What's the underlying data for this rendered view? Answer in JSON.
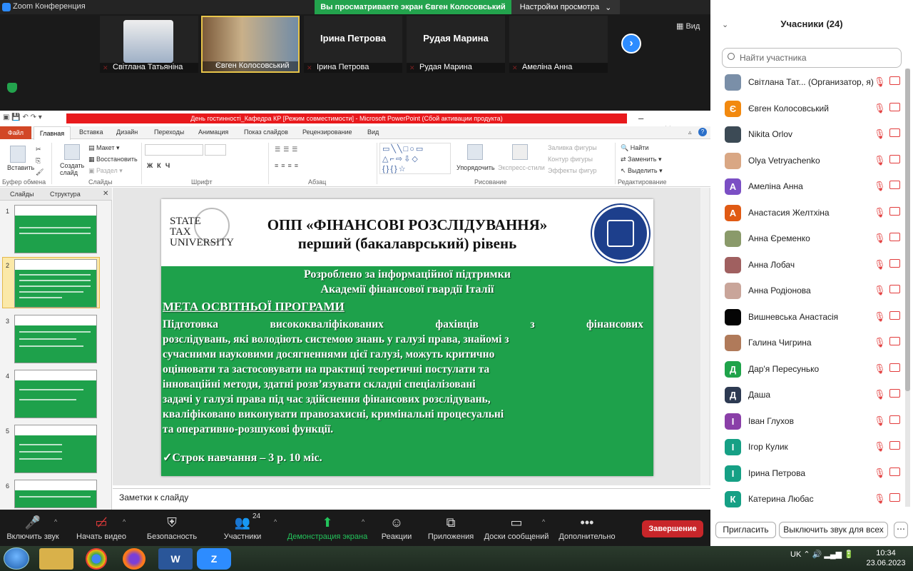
{
  "app": {
    "title": "Zoom Конференция",
    "share_banner": "Вы просматриваете экран Євген Колосовський",
    "view_settings": "Настройки просмотра",
    "view_button": "Вид"
  },
  "gallery": [
    {
      "name": "Світлана Татьяніна",
      "photo": true,
      "color": "#7a8fa8"
    },
    {
      "name": "Євген Колосовський",
      "photo": true,
      "color": "#8b6b4a"
    },
    {
      "name": "Ірина Петрова",
      "display": "Ірина Петрова"
    },
    {
      "name": "Рудая Марина",
      "display": "Рудая Марина"
    },
    {
      "name": "Амеліна Анна",
      "display": ""
    }
  ],
  "ppt": {
    "title": "День гостинності_Кафедра КР [Режим совместимости] - Microsoft PowerPoint (Сбой активации продукта)",
    "tabs": [
      "Файл",
      "Главная",
      "Вставка",
      "Дизайн",
      "Переходы",
      "Анимация",
      "Показ слайдов",
      "Рецензирование",
      "Вид"
    ],
    "groups": [
      "Буфер обмена",
      "Слайды",
      "Шрифт",
      "Абзац",
      "Рисование",
      "Редактирование"
    ],
    "clip": {
      "paste": "Вставить"
    },
    "slides": {
      "create": "Создать слайд",
      "layout": "Макет",
      "restore": "Восстановить",
      "section": "Раздел"
    },
    "draw": {
      "arrange": "Упорядочить",
      "quick": "Экспресс-стили",
      "fill": "Заливка фигуры",
      "outline": "Контур фигуры",
      "effects": "Эффекты фигур"
    },
    "edit": {
      "find": "Найти",
      "replace": "Заменить",
      "select": "Выделить"
    },
    "pane_tabs": [
      "Слайды",
      "Структура"
    ],
    "thumbs": [
      "1",
      "2",
      "3",
      "4",
      "5",
      "6"
    ],
    "notes": "Заметки к слайду"
  },
  "slide": {
    "logo_text": "STATE TAX UNIVERSITY",
    "title1": "ОПП «ФІНАНСОВІ РОЗСЛІДУВАННЯ»",
    "title2": "перший (бакалаврський) рівень",
    "l1": "Розроблено за інформаційної підтримки",
    "l2": "Академії фінансової гвардії Італії",
    "heading": "МЕТА ОСВІТНЬОЇ ПРОГРАМИ",
    "body": [
      "Підготовка висококваліфікованих фахівців з фінансових",
      "розслідувань, які володіють системою знань у галузі права, знайомі з",
      "сучасними науковими досягненнями цієї галузі, можуть критично",
      "оцінювати та застосовувати на практиці теоретичні постулати та",
      "інноваційні методи, здатні розв’язувати складні спеціалізовані",
      "задачі у галузі права під час здійснення фінансових розслідувань,",
      "кваліфіковано виконувати правозахисні, кримінальні процесуальні",
      "та оперативно-розшукові функції."
    ],
    "term": "✓Строк навчання – 3 р. 10 міс."
  },
  "participants": {
    "header": "Учасники (24)",
    "search_placeholder": "Найти участника",
    "list": [
      {
        "name": "Світлана Тат... (Организатор, я)",
        "avatar": "",
        "color": "#7a8fa8"
      },
      {
        "name": "Євген Колосовський",
        "avatar": "Є",
        "color": "#f2890f"
      },
      {
        "name": "Nikita Orlov",
        "avatar": "",
        "color": "#3c4a55"
      },
      {
        "name": "Olya Vetryachenko",
        "avatar": "",
        "color": "#d9a784"
      },
      {
        "name": "Амеліна Анна",
        "avatar": "А",
        "color": "#7b4fc4"
      },
      {
        "name": "Анастасия Желтхіна",
        "avatar": "А",
        "color": "#e05a14"
      },
      {
        "name": "Анна Єременко",
        "avatar": "",
        "color": "#8a9a6a"
      },
      {
        "name": "Анна Лобач",
        "avatar": "",
        "color": "#a06060"
      },
      {
        "name": "Анна Родіонова",
        "avatar": "",
        "color": "#c9a59a"
      },
      {
        "name": "Вишневська Анастасія",
        "avatar": "",
        "color": "#050505"
      },
      {
        "name": "Галина Чигрина",
        "avatar": "",
        "color": "#b07a5a"
      },
      {
        "name": "Дар'я Пересунько",
        "avatar": "Д",
        "color": "#1fa34a"
      },
      {
        "name": "Даша",
        "avatar": "Д",
        "color": "#2d3a52"
      },
      {
        "name": "Іван Глухов",
        "avatar": "І",
        "color": "#8a3fa8"
      },
      {
        "name": "Ігор Кулик",
        "avatar": "І",
        "color": "#16a085"
      },
      {
        "name": "Ірина Петрова",
        "avatar": "І",
        "color": "#16a085"
      },
      {
        "name": "Катерина Любас",
        "avatar": "К",
        "color": "#16a085"
      }
    ],
    "invite": "Пригласить",
    "mute_all": "Выключить звук для всех",
    "more": "⋯"
  },
  "toolbar": {
    "unmute": "Включить звук",
    "video": "Начать видео",
    "security": "Безопасность",
    "participants": "Участники",
    "participants_count": "24",
    "share": "Демонстрация экрана",
    "reactions": "Реакции",
    "apps": "Приложения",
    "whiteboards": "Доски сообщений",
    "more": "Дополнительно",
    "end": "Завершение"
  },
  "taskbar": {
    "lang": "UK",
    "time": "10:34",
    "date": "23.06.2023"
  }
}
